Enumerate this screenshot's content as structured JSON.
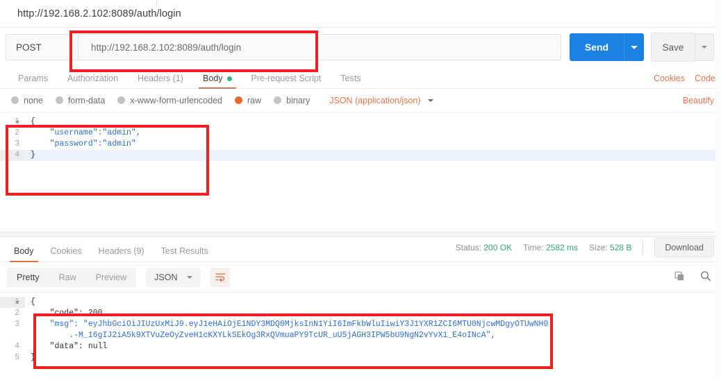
{
  "window": {
    "request_title": "http://192.168.2.102:8089/auth/login"
  },
  "urlbar": {
    "method": "POST",
    "url": "http://192.168.2.102:8089/auth/login",
    "send_label": "Send",
    "save_label": "Save"
  },
  "request_tabs": [
    {
      "label": "Params",
      "active": false,
      "dot": false
    },
    {
      "label": "Authorization",
      "active": false,
      "dot": false
    },
    {
      "label": "Headers (1)",
      "active": false,
      "dot": false
    },
    {
      "label": "Body",
      "active": true,
      "dot": true
    },
    {
      "label": "Pre-request Script",
      "active": false,
      "dot": false
    },
    {
      "label": "Tests",
      "active": false,
      "dot": false
    }
  ],
  "request_tabs_right": [
    {
      "label": "Cookies"
    },
    {
      "label": "Code"
    }
  ],
  "body_types": [
    {
      "label": "none",
      "selected": false
    },
    {
      "label": "form-data",
      "selected": false
    },
    {
      "label": "x-www-form-urlencoded",
      "selected": false
    },
    {
      "label": "raw",
      "selected": true
    },
    {
      "label": "binary",
      "selected": false
    }
  ],
  "body_format": {
    "selected": "JSON (application/json)",
    "beautify_label": "Beautify"
  },
  "request_body": {
    "lines": [
      {
        "num": "1",
        "fold": true,
        "highlight": false,
        "text": "{"
      },
      {
        "num": "2",
        "fold": false,
        "highlight": false,
        "text": "    \"username\":\"admin\","
      },
      {
        "num": "3",
        "fold": false,
        "highlight": false,
        "text": "    \"password\":\"admin\""
      },
      {
        "num": "4",
        "fold": false,
        "highlight": true,
        "text": "}"
      }
    ]
  },
  "response_tabs": [
    {
      "label": "Body",
      "active": true
    },
    {
      "label": "Cookies",
      "active": false
    },
    {
      "label": "Headers (9)",
      "active": false
    },
    {
      "label": "Test Results",
      "active": false
    }
  ],
  "response_meta": {
    "status_label": "Status:",
    "status_value": "200 OK",
    "time_label": "Time:",
    "time_value": "2582 ms",
    "size_label": "Size:",
    "size_value": "528 B",
    "download_label": "Download"
  },
  "response_toolbar": {
    "views": [
      {
        "label": "Pretty",
        "active": true
      },
      {
        "label": "Raw",
        "active": false
      },
      {
        "label": "Preview",
        "active": false
      }
    ],
    "format": "JSON",
    "wrap_icon": "word-wrap-icon",
    "copy_icon": "copy-icon",
    "search_icon": "search-icon"
  },
  "response_body": {
    "lines": [
      {
        "num": "1",
        "fold": true,
        "text": "{"
      },
      {
        "num": "2",
        "fold": false,
        "text": "    \"code\": 200,"
      },
      {
        "num": "3",
        "fold": false,
        "text": "    \"msg\": \"eyJhbGciOiJIUzUxMiJ9.eyJ1eHAiOjE1NDY3MDQ0MjksInN1YiI6ImFkbWluIiwiY3J1YXR1ZCI6MTU0NjcwMDgyOTUwNH0"
      },
      {
        "num": "",
        "fold": false,
        "text": "        .-M_16gIJ2iA5k9XTVuZeOyZveH1cKXYLkSEkOg3RxQVmuaPY9TcUR_uU5jAGH3IPW5bU9NgN2vYvX1_E4oINcA\","
      },
      {
        "num": "4",
        "fold": false,
        "text": "    \"data\": null"
      },
      {
        "num": "5",
        "fold": false,
        "text": "}"
      }
    ]
  },
  "annotations": {
    "color": "#f02020",
    "boxes": [
      {
        "name": "url-field-highlight"
      },
      {
        "name": "request-body-highlight"
      },
      {
        "name": "response-body-highlight"
      }
    ]
  }
}
